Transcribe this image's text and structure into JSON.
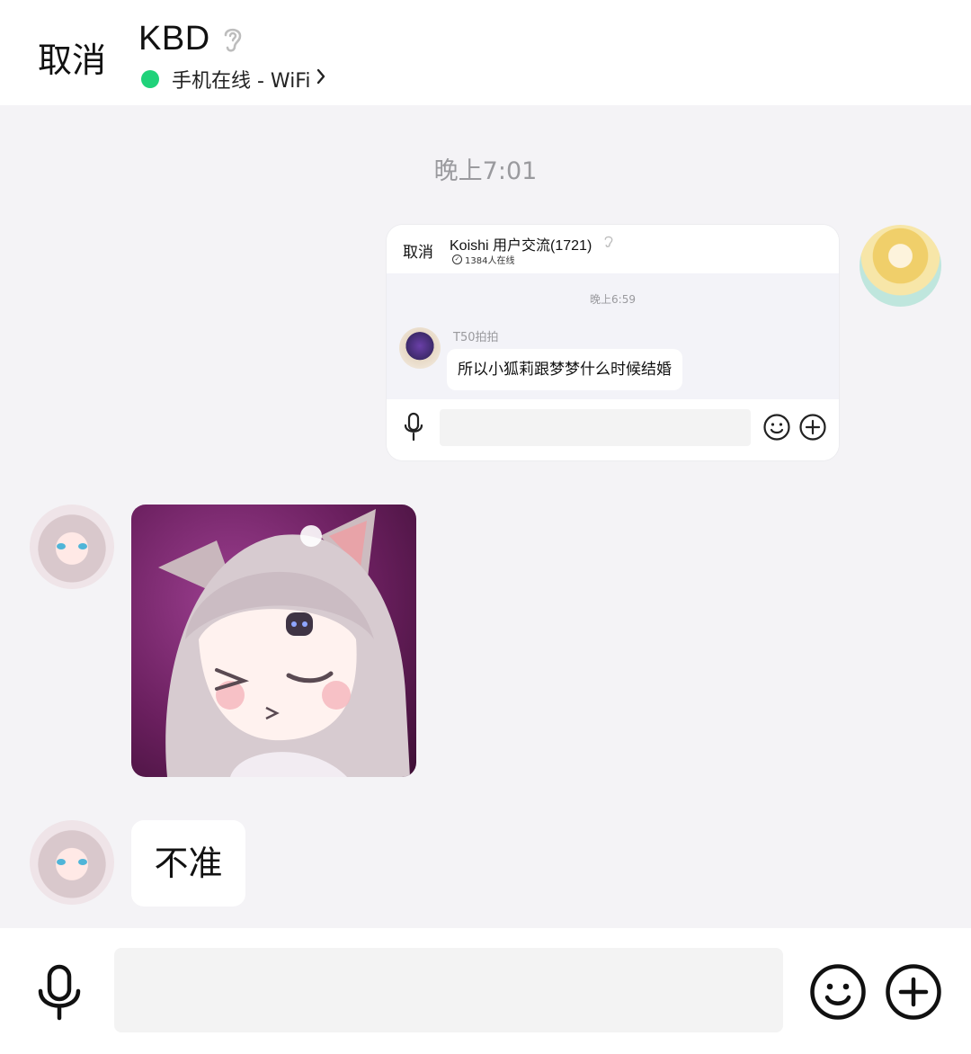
{
  "header": {
    "cancel_label": "取消",
    "title": "KBD",
    "status_text": "手机在线 - WiFi",
    "status_color": "#20d27a",
    "ear_icon": "ear-icon",
    "chevron_icon": "chevron-right-icon"
  },
  "chat": {
    "time_divider": "晚上7:01",
    "forwarded_card": {
      "cancel_label": "取消",
      "group_title": "Koishi 用户交流(1721)",
      "online_count": "1384人在线",
      "time_divider": "晚上6:59",
      "sender_name": "T50拍拍",
      "message_text": "所以小狐莉跟梦梦什么时候结婚"
    },
    "reply_text": "不准"
  },
  "input_bar": {
    "mic_icon": "microphone-icon",
    "emoji_icon": "emoji-icon",
    "plus_icon": "plus-icon"
  }
}
